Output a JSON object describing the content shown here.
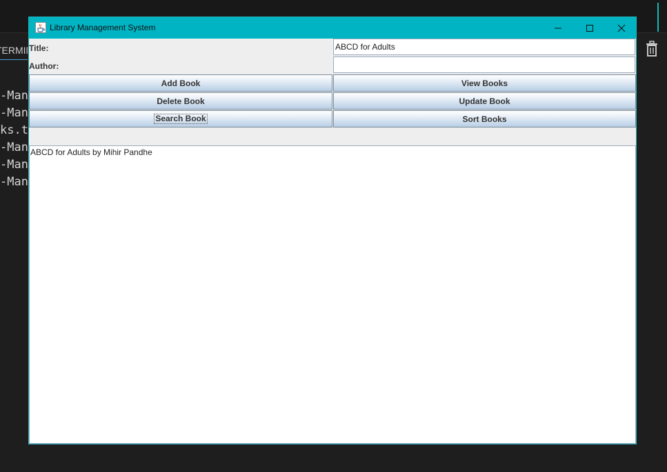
{
  "background": {
    "tab_label": "TERMINAL",
    "lines": [
      "-Mana",
      "-Mana",
      "ks.t",
      "-Mana",
      "-Mana",
      "-Mana"
    ]
  },
  "window": {
    "title": "Library Management System",
    "accent_color": "#00b4c3"
  },
  "form": {
    "title_label": "Title:",
    "title_value": "ABCD for Adults",
    "author_label": "Author:",
    "author_value": ""
  },
  "buttons": {
    "add": "Add Book",
    "view": "View Books",
    "delete": "Delete Book",
    "update": "Update Book",
    "search": "Search Book",
    "sort": "Sort Books"
  },
  "output": {
    "text": "ABCD for Adults by Mihir Pandhe"
  }
}
